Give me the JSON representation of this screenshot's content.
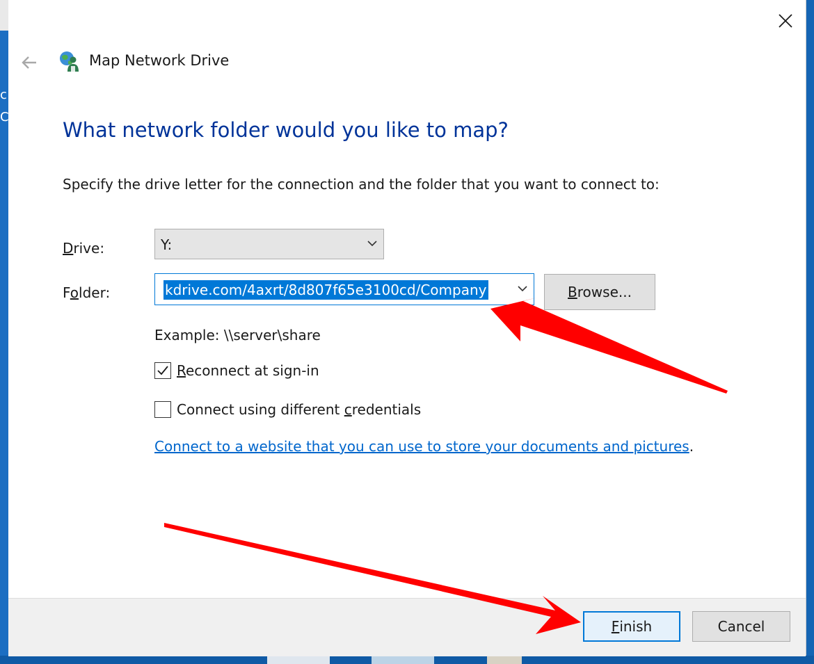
{
  "dialog": {
    "title": "Map Network Drive",
    "heading": "What network folder would you like to map?",
    "instruction": "Specify the drive letter for the connection and the folder that you want to connect to:"
  },
  "drive": {
    "label_key": "D",
    "label_rest": "rive:",
    "value": "Y:"
  },
  "folder": {
    "label_pre": "F",
    "label_key": "o",
    "label_rest": "lder:",
    "value": "kdrive.com/4axrt/8d807f65e3100cd/Company"
  },
  "browse": {
    "key": "B",
    "rest": "rowse..."
  },
  "example_text": "Example: \\\\server\\share",
  "reconnect": {
    "key": "R",
    "rest": "econnect at sign-in",
    "checked": true
  },
  "credentials": {
    "pre": "Connect using different ",
    "key": "c",
    "rest": "redentials",
    "checked": false
  },
  "website_link": {
    "text": "Connect to a website that you can use to store your documents and pictures",
    "suffix": "."
  },
  "buttons": {
    "finish_key": "F",
    "finish_rest": "inish",
    "cancel": "Cancel"
  },
  "annotation_color": "#ff0000",
  "accent_color": "#0078d7",
  "heading_color": "#003399"
}
